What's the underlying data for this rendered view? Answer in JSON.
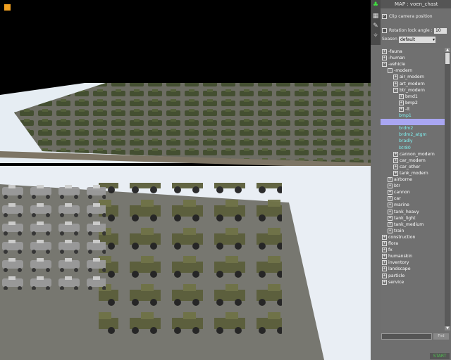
{
  "header": {
    "map_label": "MAP : voen_chast"
  },
  "options": {
    "clip_camera_label": "Clip camera position",
    "clip_camera_checked": true,
    "rotation_lock_label": "Rotation lock angle :",
    "rotation_lock_checked": false,
    "rotation_lock_value": "10",
    "season_label": "Season",
    "season_value": "default"
  },
  "tree": [
    {
      "text": "-fauna",
      "level": 0,
      "box": "+"
    },
    {
      "text": "-human",
      "level": 0,
      "box": "+"
    },
    {
      "text": "-vehicle",
      "level": 0,
      "box": "-"
    },
    {
      "text": "-modern",
      "level": 1,
      "box": "-"
    },
    {
      "text": "air_modern",
      "level": 2,
      "box": "+"
    },
    {
      "text": "art_modern",
      "level": 2,
      "box": "+"
    },
    {
      "text": "btr_modern",
      "level": 2,
      "box": "-"
    },
    {
      "text": "bmd1",
      "level": 3,
      "box": "+"
    },
    {
      "text": "bmp2",
      "level": 3,
      "box": "+"
    },
    {
      "text": "-lt",
      "level": 3,
      "box": "+"
    },
    {
      "text": "bmp1",
      "level": 3,
      "leaf": true
    },
    {
      "text": "",
      "level": 3,
      "leaf": true,
      "selected": true
    },
    {
      "text": "brdm2",
      "level": 3,
      "leaf": true
    },
    {
      "text": "brdm2_atgm",
      "level": 3,
      "leaf": true
    },
    {
      "text": "bradly",
      "level": 3,
      "leaf": true
    },
    {
      "text": "btr80",
      "level": 3,
      "leaf": true
    },
    {
      "text": "cannon_modern",
      "level": 2,
      "box": "+"
    },
    {
      "text": "car_modern",
      "level": 2,
      "box": "+"
    },
    {
      "text": "car_other",
      "level": 2,
      "box": "+"
    },
    {
      "text": "tank_modern",
      "level": 2,
      "box": "+"
    },
    {
      "text": "airborne",
      "level": 1,
      "box": "+"
    },
    {
      "text": "btr",
      "level": 1,
      "box": "+"
    },
    {
      "text": "cannon",
      "level": 1,
      "box": "+"
    },
    {
      "text": "car",
      "level": 1,
      "box": "+"
    },
    {
      "text": "marine",
      "level": 1,
      "box": "+"
    },
    {
      "text": "tank_heavy",
      "level": 1,
      "box": "+"
    },
    {
      "text": "tank_light",
      "level": 1,
      "box": "+"
    },
    {
      "text": "tank_medium",
      "level": 1,
      "box": "+"
    },
    {
      "text": "train",
      "level": 1,
      "box": "+"
    },
    {
      "text": "construction",
      "level": 0,
      "box": "+"
    },
    {
      "text": "flora",
      "level": 0,
      "box": "+"
    },
    {
      "text": "fx",
      "level": 0,
      "box": "+"
    },
    {
      "text": "humanskin",
      "level": 0,
      "box": "+"
    },
    {
      "text": "inventory",
      "level": 0,
      "box": "+"
    },
    {
      "text": "landscape",
      "level": 0,
      "box": "+"
    },
    {
      "text": "particle",
      "level": 0,
      "box": "+"
    },
    {
      "text": "service",
      "level": 0,
      "box": "+"
    }
  ],
  "footer": {
    "browse_label": "Fnd",
    "start_label": "START"
  },
  "colors": {
    "accent_orange": "#f0a020",
    "selection": "#a9a6f2",
    "leaf_text": "#7ff0f0",
    "start_green": "#4ec04e"
  },
  "icons": [
    "tree-icon",
    "grid-icon",
    "brush-icon",
    "settings-icon"
  ]
}
